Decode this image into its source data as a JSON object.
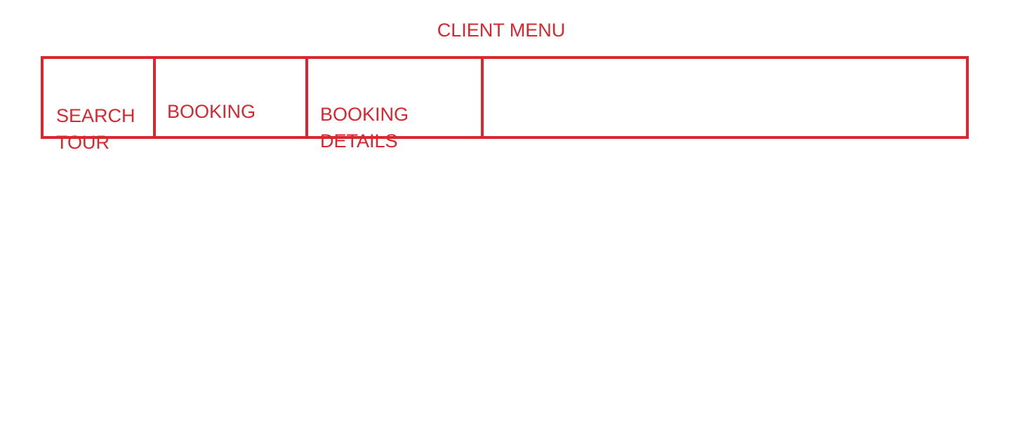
{
  "header": {
    "title": "CLIENT MENU"
  },
  "menu": {
    "items": [
      {
        "label": "SEARCH\nTOUR"
      },
      {
        "label": "BOOKING"
      },
      {
        "label": "BOOKING\nDETAILS"
      }
    ]
  },
  "colors": {
    "accent": "#d9262f",
    "background": "#ffffff"
  }
}
